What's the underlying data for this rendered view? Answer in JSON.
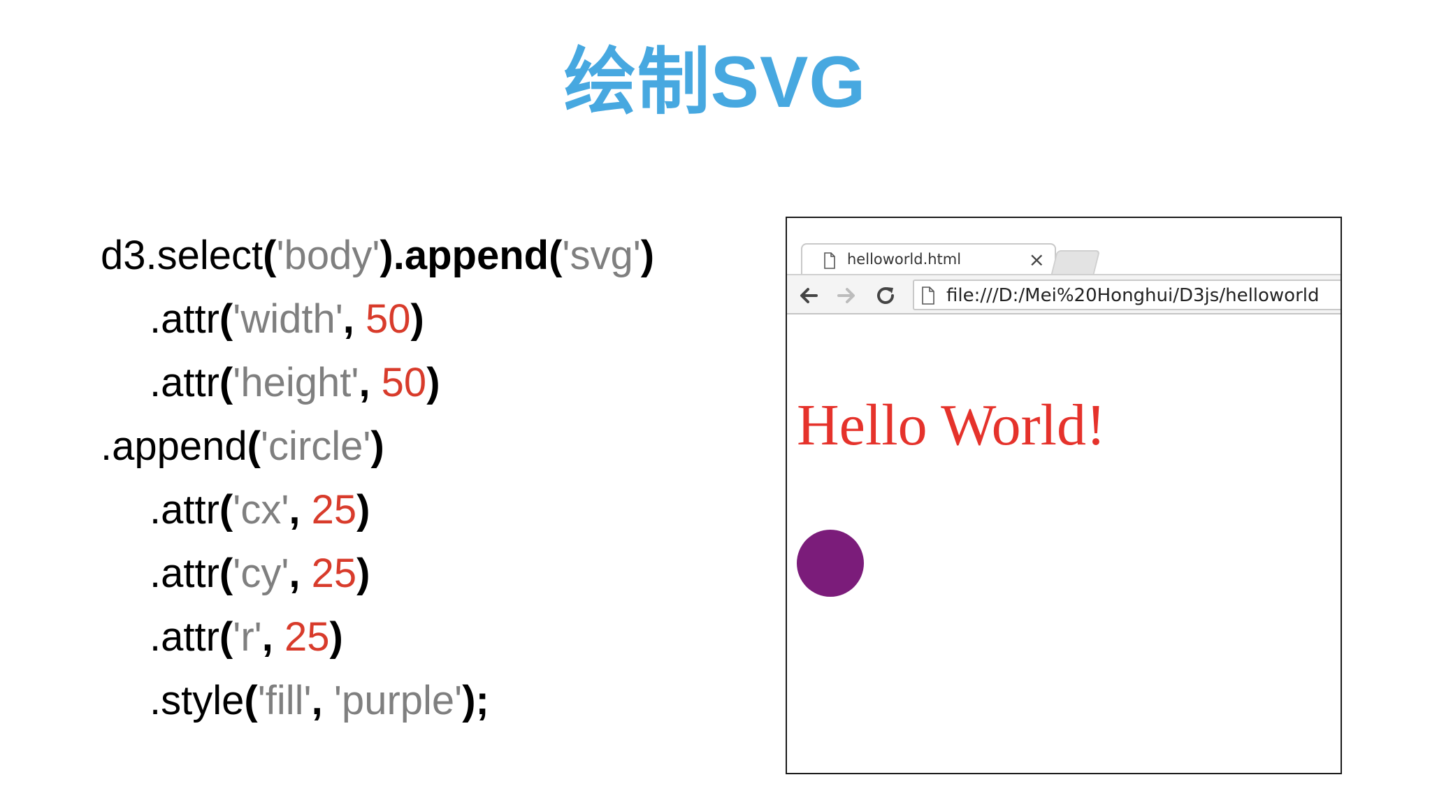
{
  "slide": {
    "title": "绘制SVG"
  },
  "code": [
    {
      "indent": false,
      "tokens": [
        {
          "t": "d3.select",
          "c": "p-plain"
        },
        {
          "t": "(",
          "c": "p"
        },
        {
          "t": "'body'",
          "c": "s"
        },
        {
          "t": ").append(",
          "c": "p"
        },
        {
          "t": "'svg'",
          "c": "s"
        },
        {
          "t": ")",
          "c": "p"
        }
      ]
    },
    {
      "indent": true,
      "tokens": [
        {
          "t": ".attr",
          "c": "p-plain"
        },
        {
          "t": "(",
          "c": "p"
        },
        {
          "t": "'width'",
          "c": "s"
        },
        {
          "t": ", ",
          "c": "p"
        },
        {
          "t": "50",
          "c": "n"
        },
        {
          "t": ")",
          "c": "p"
        }
      ]
    },
    {
      "indent": true,
      "tokens": [
        {
          "t": ".attr",
          "c": "p-plain"
        },
        {
          "t": "(",
          "c": "p"
        },
        {
          "t": "'height'",
          "c": "s"
        },
        {
          "t": ", ",
          "c": "p"
        },
        {
          "t": "50",
          "c": "n"
        },
        {
          "t": ")",
          "c": "p"
        }
      ]
    },
    {
      "indent": false,
      "tokens": [
        {
          "t": ".append",
          "c": "p-plain"
        },
        {
          "t": "(",
          "c": "p"
        },
        {
          "t": "'circle'",
          "c": "s"
        },
        {
          "t": ")",
          "c": "p"
        }
      ]
    },
    {
      "indent": true,
      "tokens": [
        {
          "t": ".attr",
          "c": "p-plain"
        },
        {
          "t": "(",
          "c": "p"
        },
        {
          "t": "'cx'",
          "c": "s"
        },
        {
          "t": ", ",
          "c": "p"
        },
        {
          "t": "25",
          "c": "n"
        },
        {
          "t": ")",
          "c": "p"
        }
      ]
    },
    {
      "indent": true,
      "tokens": [
        {
          "t": ".attr",
          "c": "p-plain"
        },
        {
          "t": "(",
          "c": "p"
        },
        {
          "t": "'cy'",
          "c": "s"
        },
        {
          "t": ", ",
          "c": "p"
        },
        {
          "t": "25",
          "c": "n"
        },
        {
          "t": ")",
          "c": "p"
        }
      ]
    },
    {
      "indent": true,
      "tokens": [
        {
          "t": ".attr",
          "c": "p-plain"
        },
        {
          "t": "(",
          "c": "p"
        },
        {
          "t": "'r'",
          "c": "s"
        },
        {
          "t": ", ",
          "c": "p"
        },
        {
          "t": "25",
          "c": "n"
        },
        {
          "t": ")",
          "c": "p"
        }
      ]
    },
    {
      "indent": true,
      "tokens": [
        {
          "t": ".style",
          "c": "p-plain"
        },
        {
          "t": "(",
          "c": "p"
        },
        {
          "t": "'fill'",
          "c": "s"
        },
        {
          "t": ", ",
          "c": "p"
        },
        {
          "t": "'purple'",
          "c": "s"
        },
        {
          "t": ");",
          "c": "p"
        }
      ]
    }
  ],
  "browser": {
    "tab_title": "helloworld.html",
    "tab_close": "×",
    "address": "file:///D:/Mei%20Honghui/D3js/helloworld",
    "page_heading": "Hello World!",
    "circle_color": "#7b1c7a",
    "icons": {
      "tab": "file-icon",
      "back": "back-arrow-icon",
      "forward": "forward-arrow-icon",
      "reload": "reload-icon",
      "address": "file-icon"
    }
  },
  "colors": {
    "title": "#47a8e0",
    "string": "#7f7f7f",
    "number": "#d83b2b",
    "hello": "#e5322b"
  }
}
